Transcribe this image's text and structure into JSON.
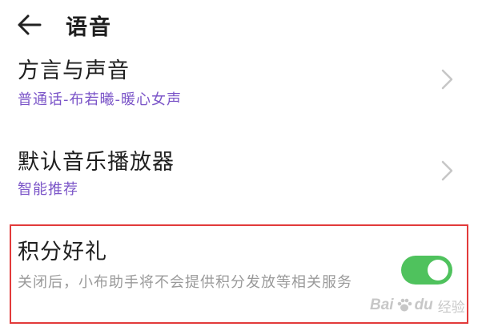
{
  "header": {
    "title": "语音",
    "back_icon": "arrow-left-icon"
  },
  "rows": [
    {
      "title": "方言与声音",
      "subtitle": "普通话-布若曦-暖心女声"
    },
    {
      "title": "默认音乐播放器",
      "subtitle": "智能推荐"
    }
  ],
  "points_row": {
    "title": "积分好礼",
    "description": "关闭后，小布助手将不会提供积分发放等相关服务",
    "toggle_on": true
  },
  "watermark": {
    "brand": "Bai",
    "paw": "paw-icon",
    "brand_tail": "du",
    "suffix": "经验"
  },
  "colors": {
    "accent_purple": "#7b55c8",
    "toggle_green": "#4fc25d",
    "highlight_red": "#e23a3a",
    "secondary_text": "#9a9a9a",
    "chevron": "#c6c6c6"
  }
}
